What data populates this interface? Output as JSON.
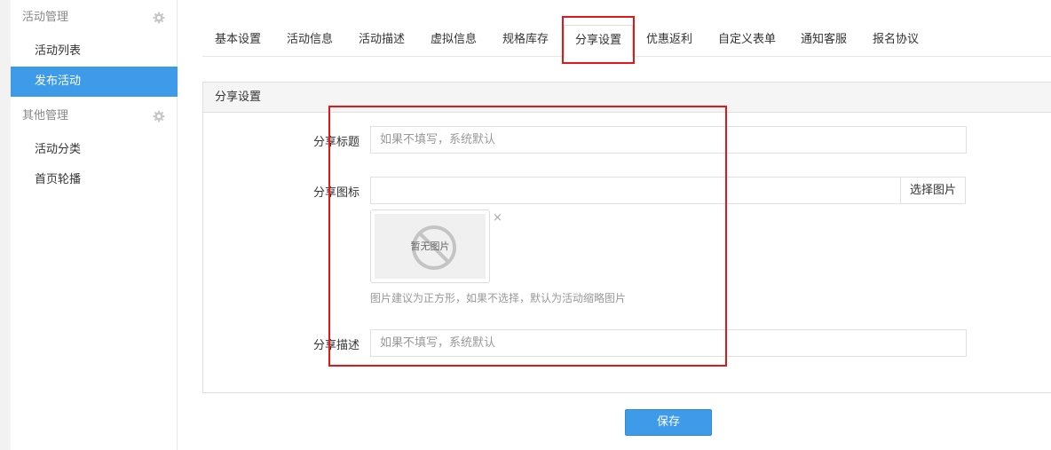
{
  "sidebar": {
    "groups": [
      {
        "title": "活动管理",
        "items": [
          "活动列表",
          "发布活动"
        ],
        "active_index": 1
      },
      {
        "title": "其他管理",
        "items": [
          "活动分类",
          "首页轮播"
        ]
      }
    ]
  },
  "tabs": [
    "基本设置",
    "活动信息",
    "活动描述",
    "虚拟信息",
    "规格库存",
    "分享设置",
    "优惠返利",
    "自定义表单",
    "通知客服",
    "报名协议"
  ],
  "active_tab": "分享设置",
  "panel": {
    "title": "分享设置",
    "share_title": {
      "label": "分享标题",
      "placeholder": "如果不填写，系统默认",
      "value": ""
    },
    "share_icon": {
      "label": "分享图标",
      "value": "",
      "pick_button": "选择图片",
      "no_image_text": "暂无图片",
      "remove_glyph": "×",
      "hint": "图片建议为正方形，如果不选择，默认为活动缩略图片"
    },
    "share_desc": {
      "label": "分享描述",
      "placeholder": "如果不填写，系统默认",
      "value": ""
    }
  },
  "save_label": "保存",
  "colors": {
    "accent": "#3d9be9",
    "highlight": "#e3161c"
  },
  "icons": {
    "group_settings": "gear-icon",
    "no_image": "no-image-icon",
    "remove": "close-icon"
  }
}
